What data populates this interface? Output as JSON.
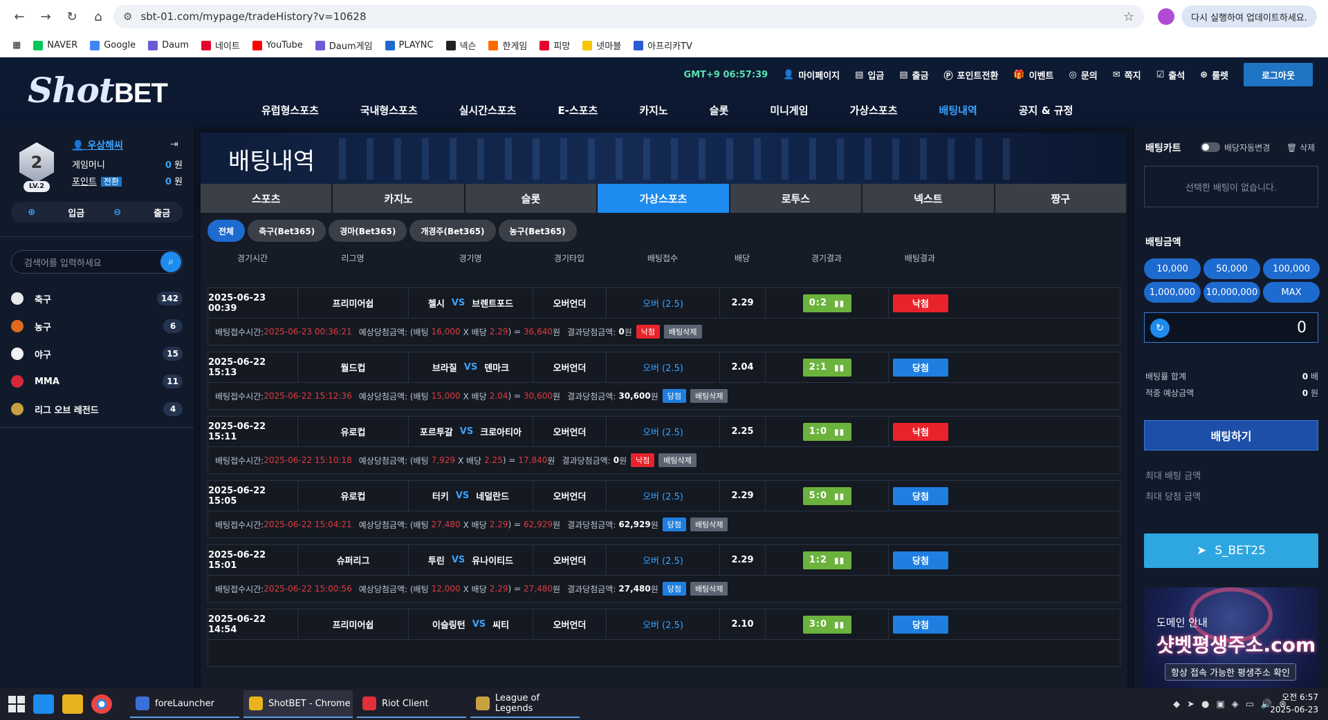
{
  "browser": {
    "url": "sbt-01.com/mypage/tradeHistory?v=10628",
    "update_label": "다시 실행하여 업데이트하세요.",
    "bookmarks": [
      {
        "label": "NAVER",
        "color": "#03c75a"
      },
      {
        "label": "Google",
        "color": "#4285f4"
      },
      {
        "label": "Daum",
        "color": "#6b5bd6"
      },
      {
        "label": "네이트",
        "color": "#e4002b"
      },
      {
        "label": "YouTube",
        "color": "#ff0000"
      },
      {
        "label": "Daum게임",
        "color": "#6b5bd6"
      },
      {
        "label": "PLAYNC",
        "color": "#1e6bd0"
      },
      {
        "label": "넥슨",
        "color": "#222"
      },
      {
        "label": "한게임",
        "color": "#ff6a00"
      },
      {
        "label": "피망",
        "color": "#e4002b"
      },
      {
        "label": "넷마블",
        "color": "#f7c600"
      },
      {
        "label": "아프리카TV",
        "color": "#2c5bd6"
      }
    ]
  },
  "header": {
    "logo_script": "Shot",
    "logo_bold": "BET",
    "time": "GMT+9 06:57:39",
    "utils": [
      {
        "label": "마이페이지",
        "icon": "user-icon"
      },
      {
        "label": "입금",
        "icon": "deposit-icon"
      },
      {
        "label": "출금",
        "icon": "withdraw-icon"
      },
      {
        "label": "포인트전환",
        "icon": "point-icon"
      },
      {
        "label": "이벤트",
        "icon": "gift-icon"
      },
      {
        "label": "문의",
        "icon": "headset-icon"
      },
      {
        "label": "쪽지",
        "icon": "mail-icon"
      },
      {
        "label": "출석",
        "icon": "calendar-icon"
      },
      {
        "label": "룰렛",
        "icon": "roulette-icon"
      }
    ],
    "logout": "로그아웃",
    "nav": [
      "유럽형스포츠",
      "국내형스포츠",
      "실시간스포츠",
      "E-스포츠",
      "카지노",
      "슬롯",
      "미니게임",
      "가상스포츠",
      "배팅내역",
      "공지 & 규정"
    ],
    "nav_active": 8
  },
  "user": {
    "level_num": "2",
    "level_label": "LV.2",
    "name": "우상해씨",
    "money_label": "게임머니",
    "money_value": "0",
    "money_unit": "원",
    "point_label": "포인트",
    "point_convert": "전환",
    "point_value": "0",
    "point_unit": "원",
    "deposit": "입금",
    "withdraw": "출금"
  },
  "search": {
    "placeholder": "검색어를 입력하세요"
  },
  "sports": [
    {
      "name": "축구",
      "count": "142",
      "color": "#e8e8e8"
    },
    {
      "name": "농구",
      "count": "6",
      "color": "#e06a1e"
    },
    {
      "name": "야구",
      "count": "15",
      "color": "#f2f2f2"
    },
    {
      "name": "MMA",
      "count": "11",
      "color": "#d9273a"
    },
    {
      "name": "리그 오브 레전드",
      "count": "4",
      "color": "#c8a040"
    }
  ],
  "page": {
    "title": "배팅내역",
    "tabs": [
      "스포츠",
      "카지노",
      "슬롯",
      "가상스포츠",
      "로투스",
      "넥스트",
      "짱구"
    ],
    "tab_active": 3,
    "subtabs": [
      "전체",
      "축구(Bet365)",
      "경마(Bet365)",
      "개경주(Bet365)",
      "농구(Bet365)"
    ],
    "subtab_active": 0,
    "columns": [
      "경기시간",
      "리그명",
      "경기명",
      "경기타입",
      "배팅접수",
      "배당",
      "경기결과",
      "배팅결과"
    ],
    "detail_labels": {
      "time": "배팅접수시간:",
      "expected": "예상당첨금액: (배팅",
      "x": "X 배당",
      "eq": ") =",
      "won": "원",
      "result": "결과당첨금액:",
      "delete": "배팅삭제"
    },
    "vs": "VS"
  },
  "bets": [
    {
      "time": "2025-06-23 00:39",
      "league": "프리미어쉽",
      "home": "첼시",
      "away": "브렌트포드",
      "type": "오버언더",
      "pick": "오버 (2.5)",
      "odds": "2.29",
      "score": "0:2",
      "result": "낙첨",
      "status": "lose",
      "bet_time": "2025-06-23 00:36:21",
      "stake": "16,000",
      "expected": "36,640",
      "payout": "0"
    },
    {
      "time": "2025-06-22 15:13",
      "league": "월드컵",
      "home": "브라질",
      "away": "덴마크",
      "type": "오버언더",
      "pick": "오버 (2.5)",
      "odds": "2.04",
      "score": "2:1",
      "result": "당첨",
      "status": "win",
      "bet_time": "2025-06-22 15:12:36",
      "stake": "15,000",
      "expected": "30,600",
      "payout": "30,600"
    },
    {
      "time": "2025-06-22 15:11",
      "league": "유로컵",
      "home": "포르투갈",
      "away": "크로아티아",
      "type": "오버언더",
      "pick": "오버 (2.5)",
      "odds": "2.25",
      "score": "1:0",
      "result": "낙첨",
      "status": "lose",
      "bet_time": "2025-06-22 15:10:18",
      "stake": "7,929",
      "expected": "17,840",
      "payout": "0"
    },
    {
      "time": "2025-06-22 15:05",
      "league": "유로컵",
      "home": "터키",
      "away": "네덜란드",
      "type": "오버언더",
      "pick": "오버 (2.5)",
      "odds": "2.29",
      "score": "5:0",
      "result": "당첨",
      "status": "win",
      "bet_time": "2025-06-22 15:04:21",
      "stake": "27,480",
      "expected": "62,929",
      "payout": "62,929"
    },
    {
      "time": "2025-06-22 15:01",
      "league": "슈퍼리그",
      "home": "투린",
      "away": "유나이티드",
      "type": "오버언더",
      "pick": "오버 (2.5)",
      "odds": "2.29",
      "score": "1:2",
      "result": "당첨",
      "status": "win",
      "bet_time": "2025-06-22 15:00:56",
      "stake": "12,000",
      "expected": "27,480",
      "payout": "27,480"
    },
    {
      "time": "2025-06-22 14:54",
      "league": "프리미어쉽",
      "home": "이슬링턴",
      "away": "씨티",
      "type": "오버언더",
      "pick": "오버 (2.5)",
      "odds": "2.10",
      "score": "3:0",
      "result": "당첨",
      "status": "win",
      "bet_time": "",
      "stake": "",
      "expected": "",
      "payout": ""
    }
  ],
  "cart": {
    "title": "배팅카트",
    "auto_label": "배당자동변경",
    "delete_label": "삭제",
    "empty": "선택한 배팅이 없습니다.",
    "amount_title": "배팅금액",
    "amounts": [
      "10,000",
      "50,000",
      "100,000",
      "1,000,000",
      "10,000,000",
      "MAX"
    ],
    "amount_value": "0",
    "odds_sum_label": "배팅률 합계",
    "odds_sum_value": "0",
    "odds_sum_unit": "배",
    "expected_label": "적중 예상금액",
    "expected_value": "0",
    "expected_unit": "원",
    "bet_button": "배팅하기",
    "max_bet": "최대 배팅 금액",
    "max_win": "최대 당첨 금액",
    "telegram": "S_BET25",
    "promo_line1": "도메인 안내",
    "promo_line2": "샷벳평생주소.com",
    "promo_line3": "항상 접속 가능한 평생주소 확인"
  },
  "taskbar": {
    "apps": [
      {
        "label": "foreLauncher",
        "color": "#3a6fd8"
      },
      {
        "label": "ShotBET - Chrome",
        "color": "#e8b31e"
      },
      {
        "label": "Riot Client",
        "color": "#e0303a"
      },
      {
        "label": "League of Legends",
        "color": "#c8a040"
      }
    ],
    "time": "오전 6:57",
    "date": "2025-06-23"
  }
}
